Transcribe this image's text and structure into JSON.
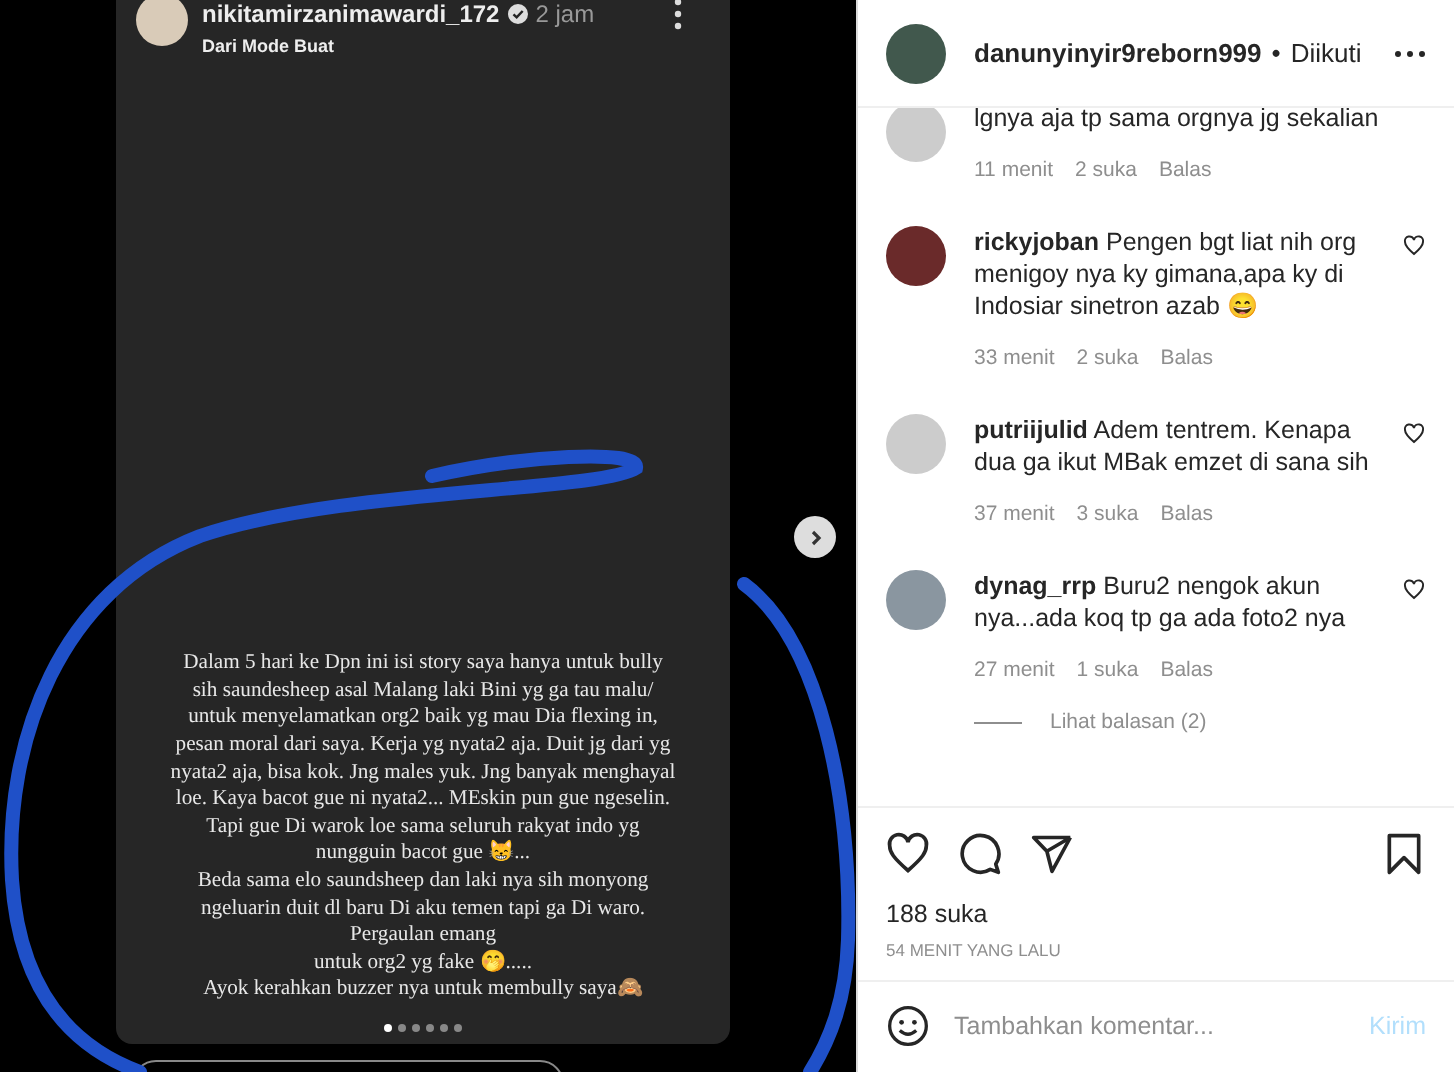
{
  "story": {
    "username": "nikitamirzanimawardi_172",
    "time": "2 jam",
    "subtitle": "Dari Mode Buat",
    "lines": [
      "Dalam 5 hari ke Dpn ini isi story saya hanya untuk bully",
      "sih saundesheep asal Malang laki Bini yg ga tau malu/",
      "untuk menyelamatkan org2 baik yg mau Dia flexing in,",
      "pesan moral dari saya. Kerja yg nyata2 aja. Duit jg dari yg",
      "nyata2 aja, bisa kok. Jng males yuk. Jng banyak menghayal",
      "loe. Kaya bacot gue ni nyata2... MEskin pun gue ngeselin.",
      "Tapi gue Di warok loe sama seluruh rakyat indo yg",
      "nungguin bacot gue 😸...",
      "Beda sama elo saundsheep dan laki nya sih monyong",
      "ngeluarin duit dl baru Di aku temen tapi ga Di waro.",
      "Pergaulan emang",
      "untuk org2 yg fake 🤭....."
    ],
    "closing": "Ayok kerahkan buzzer nya untuk membully saya🙈",
    "dots": [
      {
        "selected": true
      },
      {
        "selected": false
      },
      {
        "selected": false
      },
      {
        "selected": false
      },
      {
        "selected": false
      },
      {
        "selected": false
      }
    ]
  },
  "post": {
    "username": "danunyinyir9reborn999",
    "separator": "•",
    "status": "Diikuti",
    "comments": [
      {
        "text": "lgnya aja tp sama orgnya jg sekalian",
        "time": "11 menit",
        "likes": "2 suka",
        "reply": "Balas"
      },
      {
        "username": "rickyjoban",
        "text": "Pengen bgt liat nih org menigoy nya ky gimana,apa ky di Indosiar sinetron azab 😄",
        "time": "33 menit",
        "likes": "2 suka",
        "reply": "Balas"
      },
      {
        "username": "putriijulid",
        "text": "Adem tentrem. Kenapa dua ga ikut MBak emzet di sana sih",
        "time": "37 menit",
        "likes": "3 suka",
        "reply": "Balas"
      },
      {
        "username": "dynag_rrp",
        "text": "Buru2 nengok akun nya...ada koq tp ga ada foto2 nya",
        "time": "27 menit",
        "likes": "1 suka",
        "reply": "Balas"
      }
    ],
    "view_replies": "Lihat balasan (2)",
    "likes": "188 suka",
    "timestamp": "54 MENIT YANG LALU",
    "comment_placeholder": "Tambahkan komentar...",
    "send": "Kirim"
  }
}
